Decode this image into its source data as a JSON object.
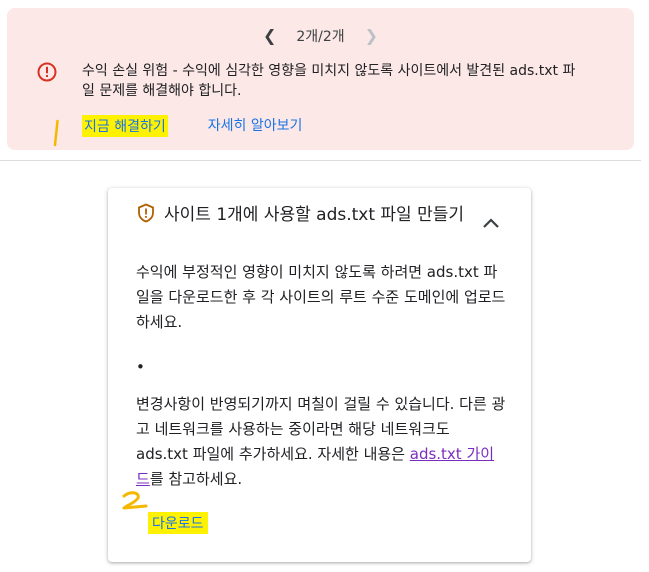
{
  "alert": {
    "pager": {
      "text": "2개/2개",
      "prev_icon": "chevron-left-icon",
      "next_icon": "chevron-right-icon"
    },
    "icon": "error-icon",
    "message": "수익 손실 위험 - 수익에 심각한 영향을 미치지 않도록 사이트에서 발견된 ads.txt 파일 문제를 해결해야 합니다.",
    "fix_label": "지금 해결하기",
    "learn_label": "자세히 알아보기",
    "bg_color": "#fce8e6",
    "icon_color": "#d93025",
    "highlight_color": "#fff200"
  },
  "annotations": {
    "mark_1": "1",
    "mark_2": "2"
  },
  "card": {
    "icon": "shield-warning-icon",
    "title": "사이트 1개에 사용할 ads.txt 파일 만들기",
    "collapse_icon": "chevron-up-icon",
    "para1": "수익에 부정적인 영향이 미치지 않도록 하려면 ads.txt 파일을 다운로드한 후 각 사이트의 루트 수준 도메인에 업로드하세요.",
    "bullet": "•",
    "para2_before": "변경사항이 반영되기까지 며칠이 걸릴 수 있습니다. 다른 광고 네트워크를 사용하는 중이라면 해당 네트워크도 ads.txt 파일에 추가하세요. 자세한 내용은 ",
    "guide_link": "ads.txt 가이드",
    "para2_after": "를 참고하세요.",
    "download_label": "다운로드"
  }
}
